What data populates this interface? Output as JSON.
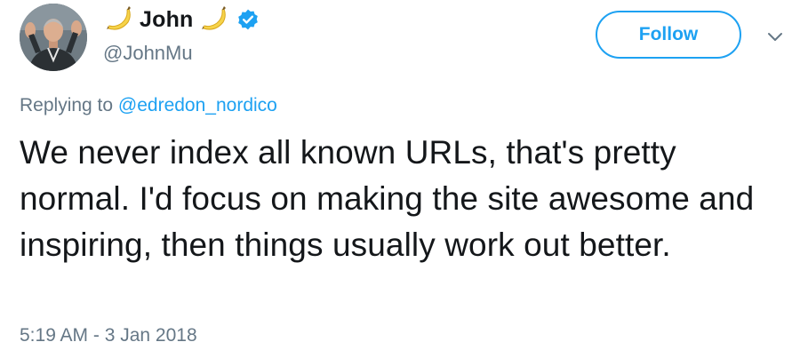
{
  "author": {
    "display_name": "John",
    "handle": "@JohnMu",
    "name_emoji": "banana-icon",
    "verified_icon": "verified-badge-icon",
    "avatar": "profile-photo"
  },
  "actions": {
    "follow_label": "Follow",
    "more_icon": "chevron-down-icon"
  },
  "reply": {
    "prefix": "Replying to",
    "mention": "@edredon_nordico"
  },
  "tweet": {
    "text": "We never index all known URLs, that's pretty normal. I'd focus on making the site awesome and inspiring, then things usually work out better.",
    "timestamp": "5:19 AM - 3 Jan 2018"
  },
  "colors": {
    "accent": "#1da1f2",
    "muted": "#657786",
    "text": "#14171a"
  }
}
